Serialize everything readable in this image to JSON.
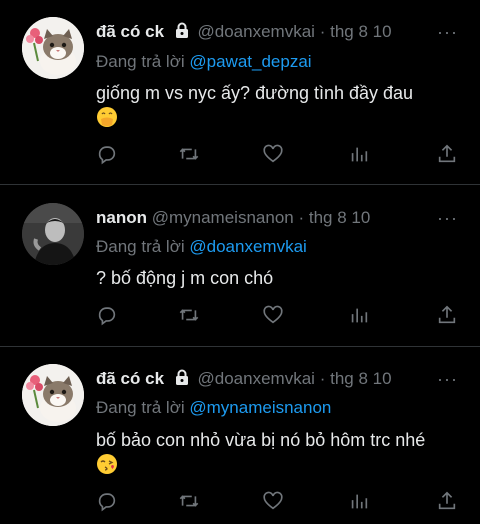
{
  "tweets": [
    {
      "name": "đã có ck",
      "locked": true,
      "handle": "@doanxemvkai",
      "dot": "·",
      "time": "thg 8 10",
      "more": "···",
      "reply_prefix": "Đang trả lời",
      "reply_to": "@pawat_depzai",
      "text": "giống m vs nyc ấy? đường tình đầy đau",
      "emoji": "face-with-hand-over-mouth"
    },
    {
      "name": "nanon",
      "locked": false,
      "handle": "@mynameisnanon",
      "dot": "·",
      "time": "thg 8 10",
      "more": "···",
      "reply_prefix": "Đang trả lời",
      "reply_to": "@doanxemvkai",
      "text": "? bố động j m con chó",
      "emoji": ""
    },
    {
      "name": "đã có ck",
      "locked": true,
      "handle": "@doanxemvkai",
      "dot": "·",
      "time": "thg 8 10",
      "more": "···",
      "reply_prefix": "Đang trả lời",
      "reply_to": "@mynameisnanon",
      "text": "bố bảo con nhỏ vừa bị nó bỏ hôm trc nhé",
      "emoji": "face-blowing-kiss"
    }
  ],
  "action_icons": [
    "reply-icon",
    "retweet-icon",
    "like-icon",
    "analytics-icon",
    "share-icon"
  ],
  "colors": {
    "background": "#000000",
    "text": "#e7e9ea",
    "muted": "#71767b",
    "link": "#1d9bf0",
    "divider": "#2f3336"
  }
}
